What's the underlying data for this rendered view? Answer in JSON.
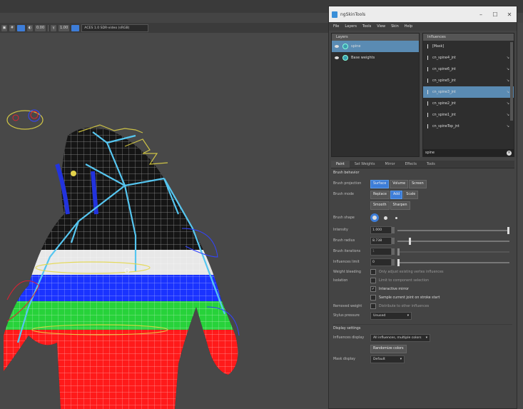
{
  "viewport": {
    "toolbar": {
      "exposure": "0.00",
      "gamma": "1.00",
      "color_space": "ACES 1.0 SDR-video (sRGB)"
    },
    "colors": {
      "bg": "#484848",
      "bone": "#56c6f0",
      "weight_red": "#ff1a1a",
      "weight_green": "#27d23a",
      "weight_blue": "#1a33ff"
    }
  },
  "window": {
    "title": "ngSkinTools",
    "menu": [
      "File",
      "Layers",
      "Tools",
      "View",
      "Skin",
      "Help"
    ],
    "layers": {
      "header": "Layers",
      "items": [
        {
          "label": "spine",
          "selected": true
        },
        {
          "label": "Base weights",
          "selected": false
        }
      ]
    },
    "influences": {
      "header": "Influences",
      "items": [
        {
          "label": "[Mask]",
          "selected": false
        },
        {
          "label": "cn_spine4_jnt",
          "selected": false
        },
        {
          "label": "cn_spine6_jnt",
          "selected": false
        },
        {
          "label": "cn_spine5_jnt",
          "selected": false
        },
        {
          "label": "cn_spine3_jnt",
          "selected": true
        },
        {
          "label": "cn_spine2_jnt",
          "selected": false
        },
        {
          "label": "cn_spine1_jnt",
          "selected": false
        },
        {
          "label": "cn_spineTop_jnt",
          "selected": false
        }
      ],
      "filter": "spine"
    },
    "tabs": [
      "Paint",
      "Set Weights",
      "Mirror",
      "Effects",
      "Tools"
    ],
    "paint": {
      "section_title": "Brush behavior",
      "brush_projection": {
        "label": "Brush projection",
        "options": [
          "Surface",
          "Volume",
          "Screen"
        ],
        "active": 0
      },
      "brush_mode": {
        "label": "Brush mode",
        "options": [
          "Replace",
          "Add",
          "Scale"
        ],
        "active": 1,
        "options2": [
          "Smooth",
          "Sharpen"
        ]
      },
      "brush_shape": {
        "label": "Brush shape"
      },
      "intensity": {
        "label": "Intensity",
        "value": "1.000",
        "level": 1.0
      },
      "brush_radius": {
        "label": "Brush radius",
        "value": "8.738",
        "level": 0.1
      },
      "brush_iterations": {
        "label": "Brush iterations",
        "value": "1",
        "level": 0.0
      },
      "influences_limit": {
        "label": "Influences limit",
        "value": "0",
        "level": 0.0
      },
      "weight_bleeding": {
        "label": "Weight bleeding",
        "text": "Only adjust existing vertex influences"
      },
      "isolation": {
        "label": "Isolation",
        "text": "Limit to component selection"
      },
      "interactive_mirror": {
        "text": "Interactive mirror",
        "checked": true
      },
      "sample_joint": {
        "text": "Sample current joint on stroke start",
        "checked": false
      },
      "removed_weight": {
        "label": "Removed weight",
        "text": "Distribute to other influences"
      },
      "stylus_pressure": {
        "label": "Stylus pressure",
        "value": "Unused"
      },
      "display_title": "Display settings",
      "influences_display": {
        "label": "Influences display",
        "value": "All influences, multiple colors"
      },
      "randomize": "Randomize colors",
      "mask_display": {
        "label": "Mask display",
        "value": "Default"
      }
    }
  }
}
